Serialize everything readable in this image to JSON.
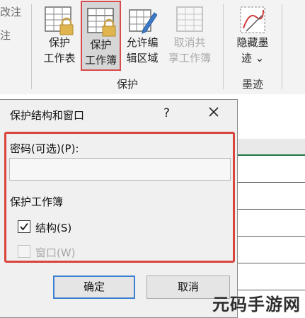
{
  "ribbon": {
    "edge_labels": [
      "改注",
      "注"
    ],
    "buttons": {
      "protect_sheet": {
        "line1": "保护",
        "line2": "工作表"
      },
      "protect_workbook": {
        "line1": "保护",
        "line2": "工作簿"
      },
      "allow_edit_ranges": {
        "line1": "允许编",
        "line2": "辑区域"
      },
      "unshare_workbook": {
        "line1": "取消共",
        "line2": "享工作簿"
      },
      "hide_ink": {
        "line1": "隐藏墨",
        "line2": "迹 ⌄"
      }
    },
    "group_protect": "保护",
    "group_ink": "墨迹"
  },
  "dialog": {
    "title": "保护结构和窗口",
    "help": "?",
    "password_label": "密码(可选)(P):",
    "password_value": "",
    "section_label": "保护工作簿",
    "structure_label": "结构(S)",
    "structure_checked": true,
    "windows_label": "窗口(W)",
    "windows_checked": false,
    "ok_label": "确定",
    "cancel_label": "取消"
  },
  "watermark": "元码手游网",
  "colors": {
    "highlight_red": "#d9453d",
    "ok_focus_blue": "#3c7fd0",
    "excel_green": "#217346"
  }
}
